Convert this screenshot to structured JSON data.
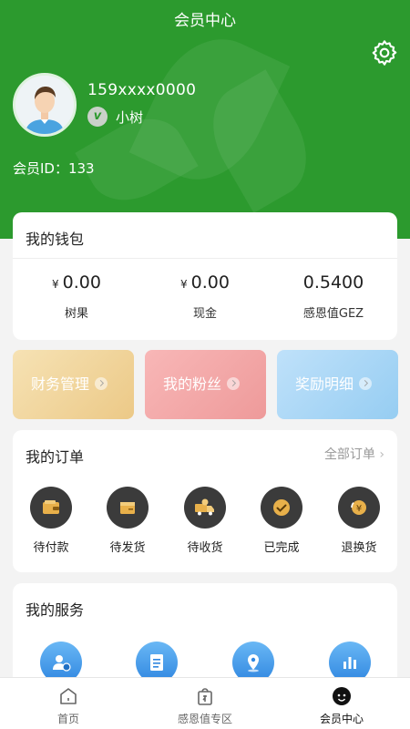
{
  "header": {
    "title": "会员中心"
  },
  "user": {
    "phone": "159xxxx0000",
    "level_badge": "v",
    "level": "小树",
    "member_id": "会员ID：133"
  },
  "wallet": {
    "title": "我的钱包",
    "items": [
      {
        "currency": "¥",
        "value": "0.00",
        "label": "树果"
      },
      {
        "currency": "¥",
        "value": "0.00",
        "label": "现金"
      },
      {
        "currency": "",
        "value": "0.5400",
        "label": "感恩值GEZ"
      }
    ]
  },
  "quick_links": [
    {
      "label": "财务管理",
      "color": "#f4d9a2"
    },
    {
      "label": "我的粉丝",
      "color": "#f3a5a5"
    },
    {
      "label": "奖励明细",
      "color": "#a9d6f5"
    }
  ],
  "orders": {
    "title": "我的订单",
    "all": "全部订单",
    "items": [
      {
        "label": "待付款",
        "icon": "wallet-icon"
      },
      {
        "label": "待发货",
        "icon": "package-icon"
      },
      {
        "label": "待收货",
        "icon": "delivery-truck-icon"
      },
      {
        "label": "已完成",
        "icon": "check-circle-icon"
      },
      {
        "label": "退换货",
        "icon": "refund-icon"
      }
    ]
  },
  "services": {
    "title": "我的服务",
    "items": [
      {
        "icon": "user-verified-icon"
      },
      {
        "icon": "document-icon"
      },
      {
        "icon": "location-pin-icon"
      },
      {
        "icon": "bar-chart-icon"
      }
    ]
  },
  "tabbar": {
    "items": [
      {
        "label": "首页",
        "icon": "home-icon",
        "active": false
      },
      {
        "label": "感恩值专区",
        "icon": "shopping-bag-icon",
        "active": false
      },
      {
        "label": "会员中心",
        "icon": "member-icon",
        "active": true
      }
    ]
  },
  "colors": {
    "brand_green": "#2c9a2e",
    "icon_dark": "#3b3b3b",
    "service_blue": "#2f86e0"
  }
}
